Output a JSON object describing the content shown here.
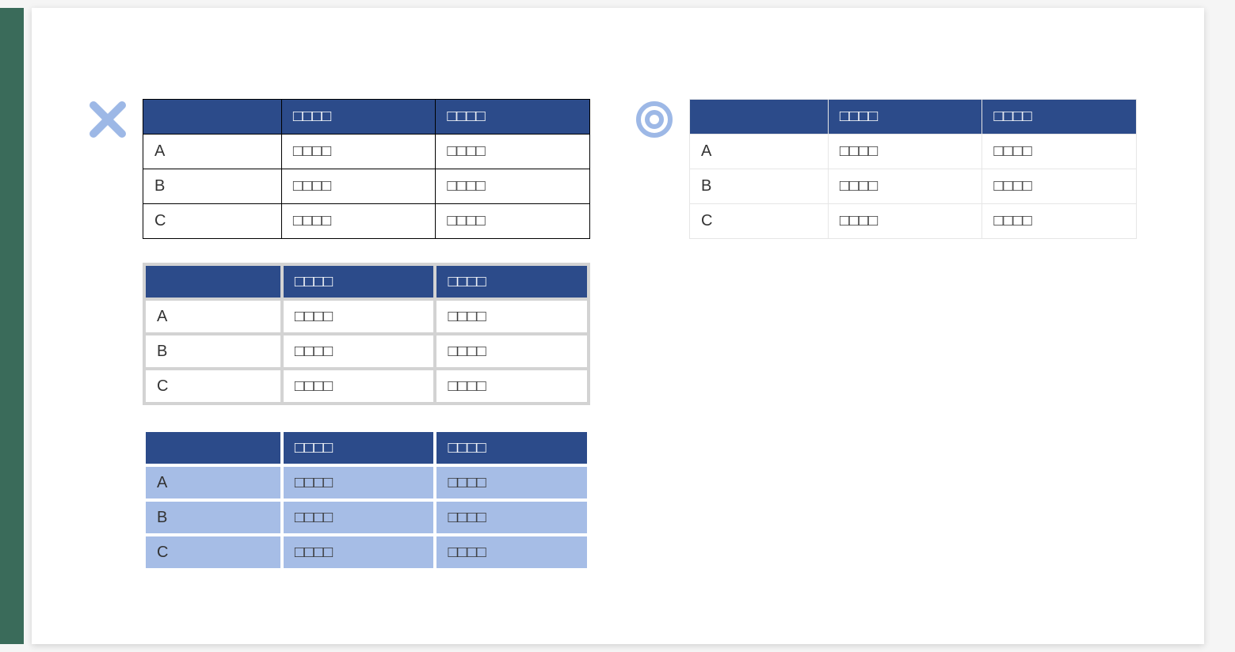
{
  "icons": {
    "bad": "cross",
    "good": "double-circle"
  },
  "colors": {
    "header_bg": "#2c4b8a",
    "header_text": "#ffffff",
    "icon_blue": "#9db8e6",
    "bad_cell_blue": "#a6bde6",
    "sidebar": "#3a6b5a"
  },
  "tables": {
    "bad1": {
      "headers": [
        "",
        "□□□□",
        "□□□□"
      ],
      "rows": [
        [
          "A",
          "□□□□",
          "□□□□"
        ],
        [
          "B",
          "□□□□",
          "□□□□"
        ],
        [
          "C",
          "□□□□",
          "□□□□"
        ]
      ]
    },
    "bad2": {
      "headers": [
        "",
        "□□□□",
        "□□□□"
      ],
      "rows": [
        [
          "A",
          "□□□□",
          "□□□□"
        ],
        [
          "B",
          "□□□□",
          "□□□□"
        ],
        [
          "C",
          "□□□□",
          "□□□□"
        ]
      ]
    },
    "bad3": {
      "headers": [
        "",
        "□□□□",
        "□□□□"
      ],
      "rows": [
        [
          "A",
          "□□□□",
          "□□□□"
        ],
        [
          "B",
          "□□□□",
          "□□□□"
        ],
        [
          "C",
          "□□□□",
          "□□□□"
        ]
      ]
    },
    "good": {
      "headers": [
        "",
        "□□□□",
        "□□□□"
      ],
      "rows": [
        [
          "A",
          "□□□□",
          "□□□□"
        ],
        [
          "B",
          "□□□□",
          "□□□□"
        ],
        [
          "C",
          "□□□□",
          "□□□□"
        ]
      ]
    }
  }
}
